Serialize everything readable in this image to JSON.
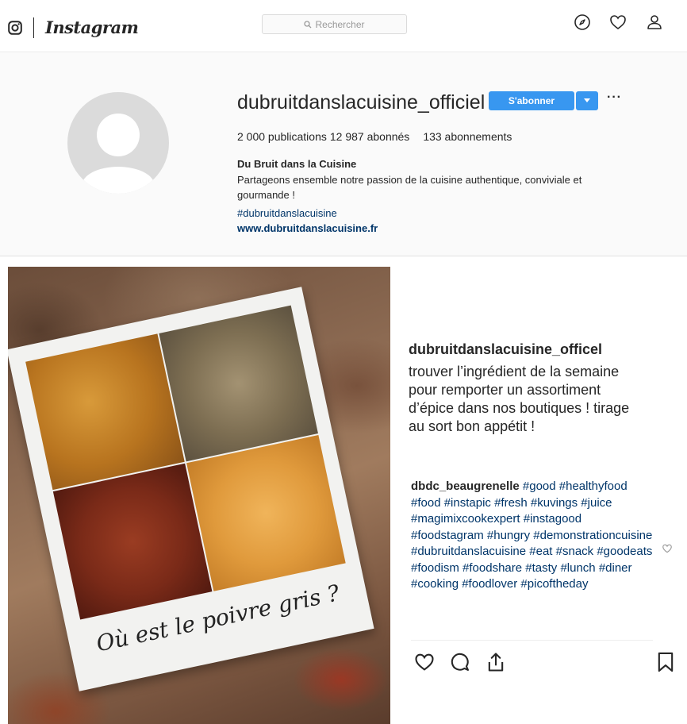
{
  "nav": {
    "brand": "Instagram",
    "search_placeholder": "Rechercher"
  },
  "profile": {
    "username": "dubruitdanslacuisine_officiel",
    "follow_label": "S'abonner",
    "more_label": "···",
    "stats": {
      "publications": "2 000 publications",
      "followers": "12 987 abonnés",
      "following": "133 abonnements"
    },
    "bio": {
      "name": "Du Bruit dans la Cuisine",
      "text": "Partageons ensemble notre passion de la cuisine authentique, conviviale et gourmande !",
      "hashtag": "#dubruitdanslacuisine",
      "link": "www.dubruitdanslacuisine.fr"
    }
  },
  "post": {
    "image_caption": "Où est le poivre gris ?",
    "author": "dubruitdanslacuisine_officel",
    "caption": "trouver l’ingrédient de la semaine pour remporter un assortiment d’épice dans nos boutiques ! tirage au sort bon appétit !",
    "comment": {
      "user": "dbdc_beaugrenelle",
      "text": "#good #healthyfood #food #instapic #fresh #kuvings #juice #magimixcookexpert #instagood #foodstagram #hungry #demonstrationcuisine #dubruitdanslacuisine #eat #snack #goodeats #foodism #foodshare #tasty #lunch #diner #cooking #foodlover #picoftheday"
    }
  },
  "icons": {
    "nav": [
      "instagram-glyph-icon",
      "compass-icon",
      "heart-icon",
      "profile-icon",
      "search-icon"
    ],
    "actions": [
      "like-icon",
      "comment-icon",
      "share-icon",
      "bookmark-icon"
    ]
  },
  "colors": {
    "accent": "#3897f0",
    "link": "#003569",
    "header_bg": "#fafafa"
  }
}
